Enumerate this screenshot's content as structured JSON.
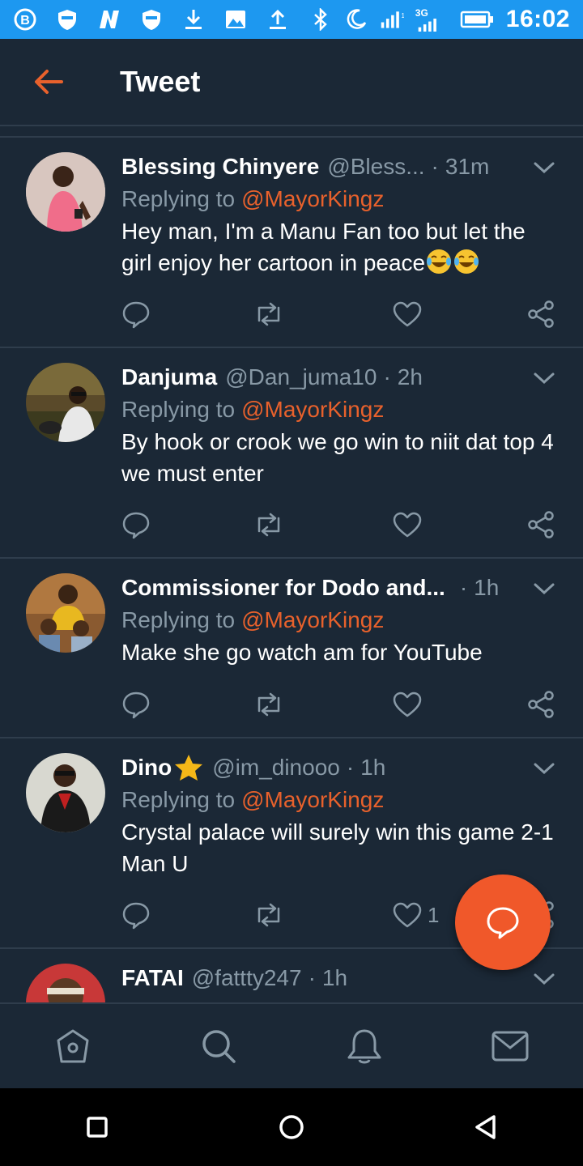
{
  "status_bar": {
    "time": "16:02",
    "network_label": "3G",
    "left_icons": [
      "b-app-icon",
      "shield-icon",
      "n-app-icon",
      "shield-icon",
      "download-icon",
      "image-icon",
      "upload-icon"
    ],
    "right_icons": [
      "bluetooth-icon",
      "moon-icon",
      "signal-icon",
      "signal-icon",
      "battery-icon"
    ]
  },
  "header": {
    "title": "Tweet"
  },
  "tweets": [
    {
      "name": "Blessing Chinyere",
      "handle": "@Bless...",
      "dot": "·",
      "time": "31m",
      "replying_label": "Replying to",
      "replying_to": "@MayorKingz",
      "text": "Hey man, I'm a Manu Fan too but let the girl enjoy her cartoon in peace",
      "emoji": "😂😂",
      "like_count": ""
    },
    {
      "name": "Danjuma",
      "handle": "@Dan_juma10",
      "dot": "·",
      "time": "2h",
      "replying_label": "Replying to",
      "replying_to": "@MayorKingz",
      "text": "By hook or crook we go win to niit dat top 4 we must enter",
      "like_count": ""
    },
    {
      "name": "Commissioner for Dodo and...",
      "handle": "",
      "dot": "·",
      "time": "1h",
      "replying_label": "Replying to",
      "replying_to": "@MayorKingz",
      "text": "Make she go watch am for YouTube",
      "like_count": ""
    },
    {
      "name": "Dino",
      "name_badge": "star-icon",
      "handle": "@im_dinooo",
      "dot": "·",
      "time": "1h",
      "replying_label": "Replying to",
      "replying_to": "@MayorKingz",
      "text": "Crystal palace will surely win this game 2-1 Man U",
      "like_count": "1"
    },
    {
      "name": "FATAI",
      "handle": "@fattty247",
      "dot": "·",
      "time": "1h"
    }
  ],
  "bottom_nav": [
    "home-icon",
    "search-icon",
    "notifications-icon",
    "messages-icon"
  ],
  "colors": {
    "background": "#1b2836",
    "accent": "#e8612c",
    "muted": "#8899a6",
    "status_bar": "#1d98f0",
    "fab": "#f0582a"
  }
}
